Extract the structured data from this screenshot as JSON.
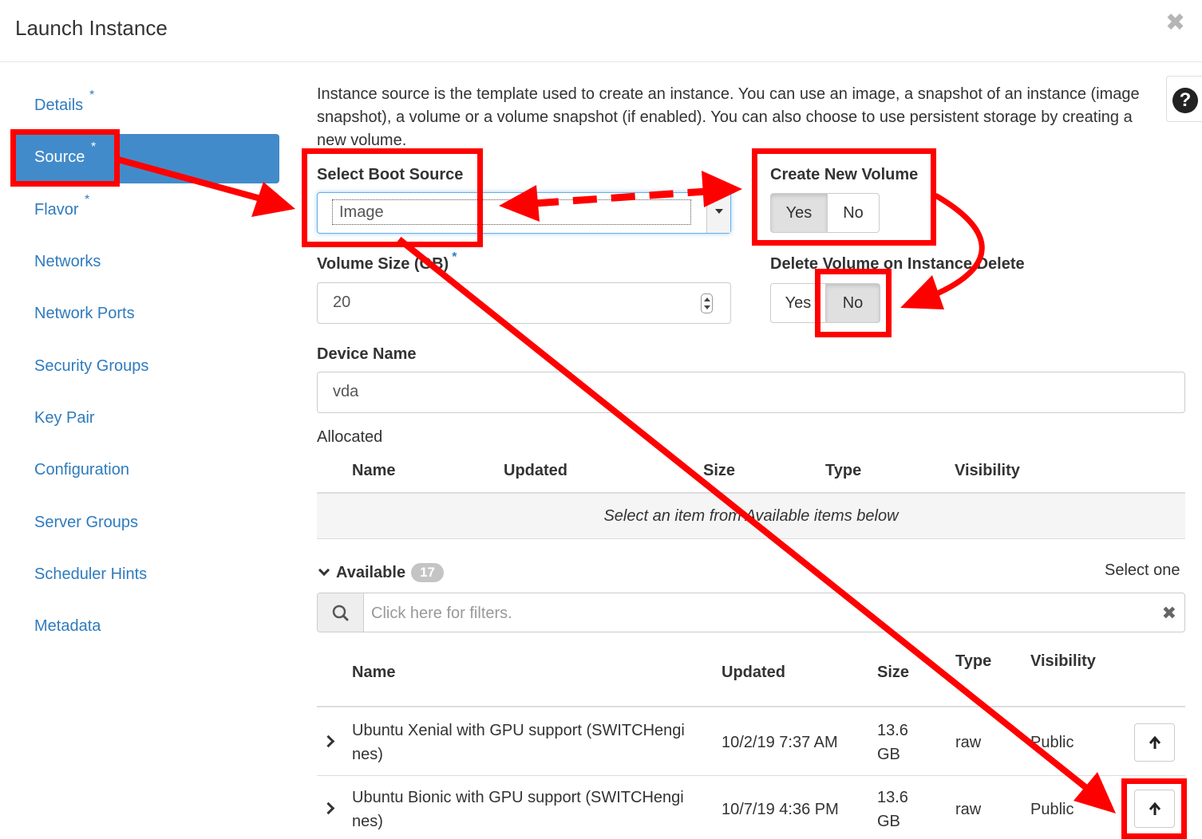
{
  "title": "Launch Instance",
  "close_icon": "close-icon",
  "nav": {
    "items": [
      {
        "label": "Details",
        "required": "*"
      },
      {
        "label": "Source",
        "required": "*"
      },
      {
        "label": "Flavor",
        "required": "*"
      },
      {
        "label": "Networks"
      },
      {
        "label": "Network Ports"
      },
      {
        "label": "Security Groups"
      },
      {
        "label": "Key Pair"
      },
      {
        "label": "Configuration"
      },
      {
        "label": "Server Groups"
      },
      {
        "label": "Scheduler Hints"
      },
      {
        "label": "Metadata"
      }
    ],
    "active": "Source"
  },
  "help_icon": "?",
  "description": "Instance source is the template used to create an instance. You can use an image, a snapshot of an instance (image snapshot), a volume or a volume snapshot (if enabled). You can also choose to use persistent storage by creating a new volume.",
  "boot_source": {
    "label": "Select Boot Source",
    "value": "Image"
  },
  "create_volume": {
    "label": "Create New Volume",
    "yes": "Yes",
    "no": "No",
    "selected": "Yes"
  },
  "volume_size": {
    "label": "Volume Size (GB)",
    "required": "*",
    "value": "20"
  },
  "delete_volume": {
    "label": "Delete Volume on Instance Delete",
    "yes": "Yes",
    "no": "No",
    "selected": "No"
  },
  "device_name": {
    "label": "Device Name",
    "value": "vda"
  },
  "allocated": {
    "label": "Allocated",
    "columns": [
      "Name",
      "Updated",
      "Size",
      "Type",
      "Visibility"
    ],
    "empty_message": "Select an item from Available items below"
  },
  "available": {
    "label": "Available",
    "count": "17",
    "select_hint": "Select one",
    "filter_placeholder": "Click here for filters.",
    "clear_icon": "✖",
    "columns": [
      "Name",
      "Updated",
      "Size",
      "Type",
      "Visibility"
    ],
    "rows": [
      {
        "name_line1": "Ubuntu Xenial with GPU support (SWITCHengi",
        "name_line2": "nes)",
        "updated": "10/2/19 7:37 AM",
        "size_line1": "13.6",
        "size_line2": "GB",
        "type": "raw",
        "visibility": "Public"
      },
      {
        "name_line1": "Ubuntu Bionic with GPU support (SWITCHengi",
        "name_line2": "nes)",
        "updated": "10/7/19 4:36 PM",
        "size_line1": "13.6",
        "size_line2": "GB",
        "type": "raw",
        "visibility": "Public"
      }
    ]
  },
  "annotation_color": "#ff0000",
  "accent_color": "#428bca",
  "link_color": "#2f7bbd"
}
